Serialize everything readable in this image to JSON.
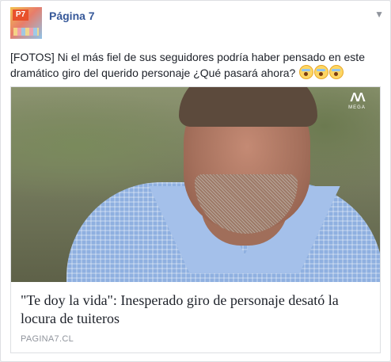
{
  "post": {
    "page_name": "Página 7",
    "avatar_text": "P7",
    "text": "[FOTOS] Ni el más fiel de sus seguidores podría haber pensado en este dramático giro del querido personaje ¿Qué pasará ahora?",
    "emojis": [
      "scream-emoji",
      "scream-emoji",
      "scream-emoji"
    ],
    "menu_icon": "chevron-down-icon"
  },
  "link_card": {
    "image_watermark": "MEGA",
    "title": "\"Te doy la vida\": Inesperado giro de personaje desató la locura de tuiteros",
    "domain": "PAGINA7.CL"
  }
}
